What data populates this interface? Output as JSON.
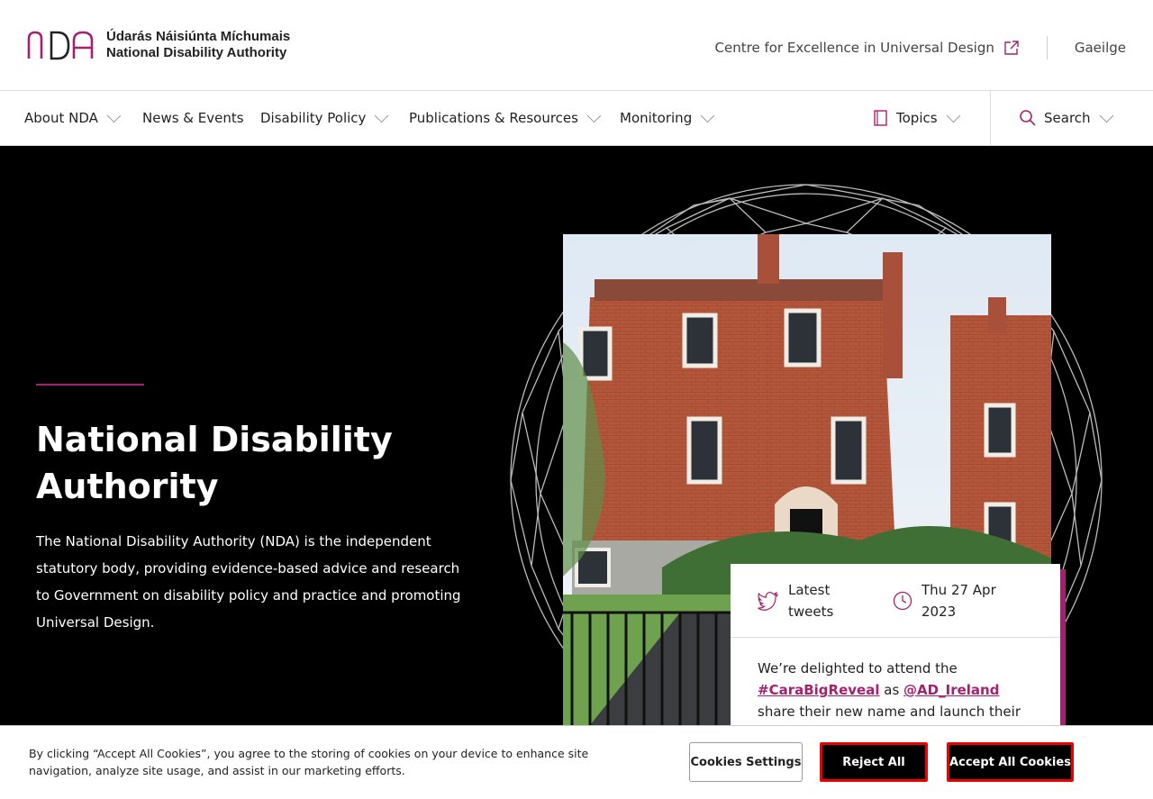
{
  "header": {
    "logo_letters": "NDA",
    "logo_line1": "Údarás Náisiúnta Míchumais",
    "logo_line2": "National Disability Authority",
    "cfeud_link": "Centre for Excellence in Universal Design",
    "language_link": "Gaeilge"
  },
  "nav": {
    "items": [
      {
        "label": "About NDA"
      },
      {
        "label": "News & Events"
      },
      {
        "label": "Disability Policy"
      },
      {
        "label": "Publications & Resources"
      },
      {
        "label": "Monitoring"
      }
    ],
    "topics_label": "Topics",
    "search_label": "Search"
  },
  "hero": {
    "title": "National Disability Authority",
    "description": "The National Disability Authority (NDA) is the independent statutory body, providing evidence-based advice and research to Government on disability policy and practice and promoting Universal Design."
  },
  "tweet": {
    "source_label": "Latest tweets",
    "date": "Thu 27 Apr 2023",
    "text_start": "We’re delighted to attend the",
    "hashtag": "#CaraBigReveal",
    "text_mid": "as",
    "mention": "@AD_Ireland",
    "text_end": "share their new name and launch their new"
  },
  "cookie": {
    "text": "By clicking “Accept All Cookies”, you agree to the storing of cookies on your device to enhance site navigation, analyze site usage, and assist in our marketing efforts.",
    "settings_label": "Cookies Settings",
    "reject_label": "Reject All",
    "accept_label": "Accept All Cookies"
  },
  "colors": {
    "brand": "#a3216f",
    "hero_bg": "#000000",
    "highlight_border": "#ee0000"
  },
  "icons": [
    "external-link-icon",
    "chevron-down-icon",
    "book-icon",
    "search-icon",
    "twitter-icon",
    "clock-icon"
  ]
}
